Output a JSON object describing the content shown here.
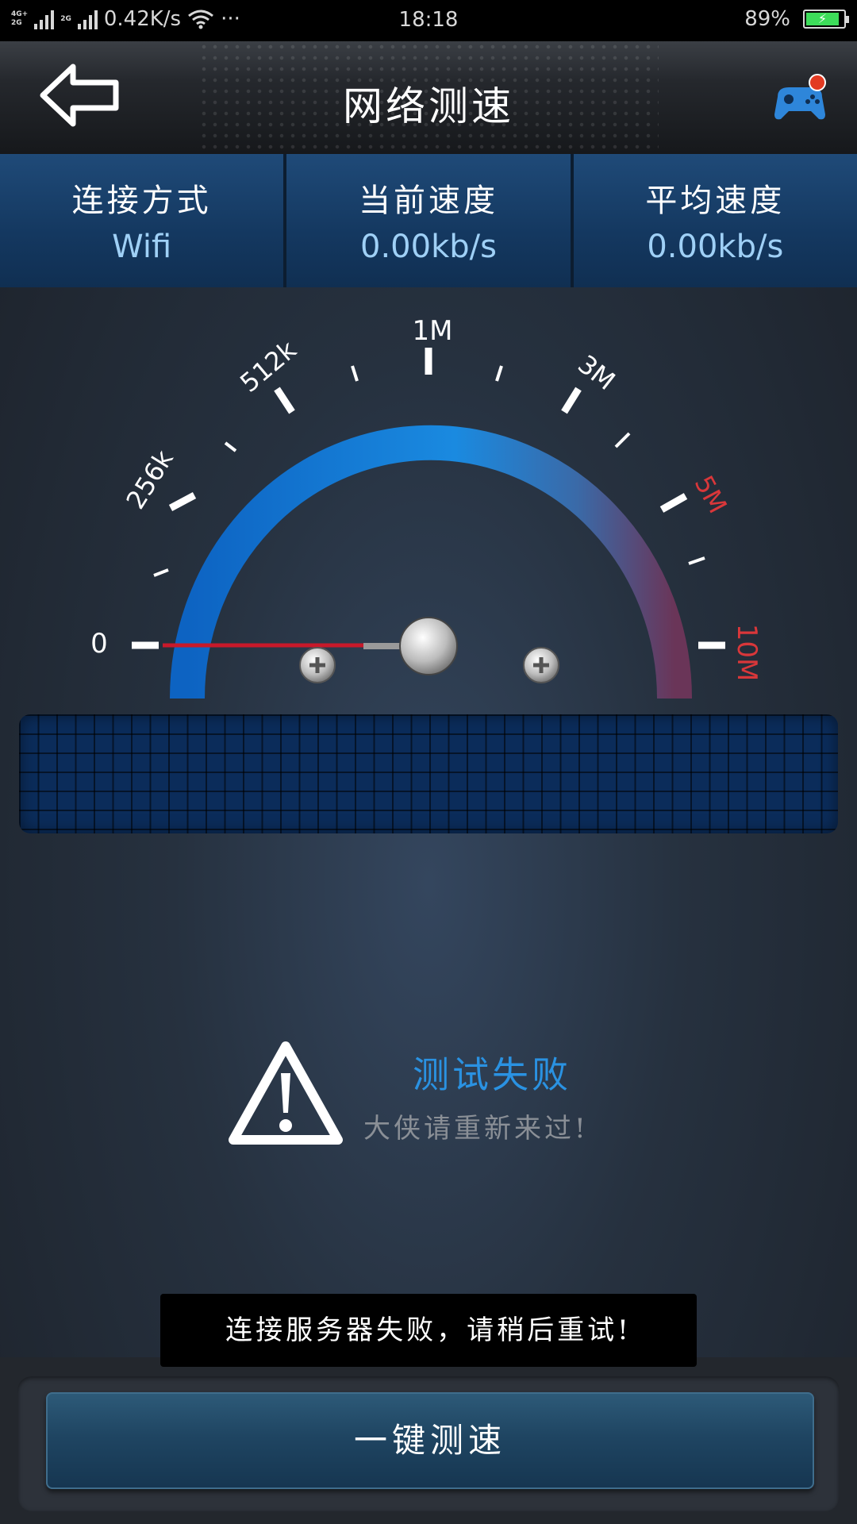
{
  "status_bar": {
    "network_type": "4G 2G",
    "network_type_2": "2G",
    "speed": "0.42K/s",
    "more": "···",
    "time": "18:18",
    "battery": "89%",
    "battery_level": 0.89
  },
  "header": {
    "title": "网络测速",
    "back_icon": "back-arrow-icon",
    "game_icon": "gamepad-icon"
  },
  "info": [
    {
      "label": "连接方式",
      "value": "Wifi"
    },
    {
      "label": "当前速度",
      "value": "0.00kb/s"
    },
    {
      "label": "平均速度",
      "value": "0.00kb/s"
    }
  ],
  "gauge": {
    "labels": {
      "zero": "0",
      "k256": "256k",
      "k512": "512k",
      "m1": "1M",
      "m3": "3M",
      "m5": "5M",
      "m10": "10M"
    },
    "current_value": 0,
    "colors": {
      "arc_start": "#1a84d8",
      "arc_end": "#6a3558",
      "needle": "#c8192a",
      "high_label": "#d9373a"
    }
  },
  "result": {
    "title": "测试失败",
    "subtitle": "大侠请重新来过!",
    "icon": "warning-icon"
  },
  "toast": "连接服务器失败，请稍后重试!",
  "button": {
    "label": "一键测速"
  }
}
